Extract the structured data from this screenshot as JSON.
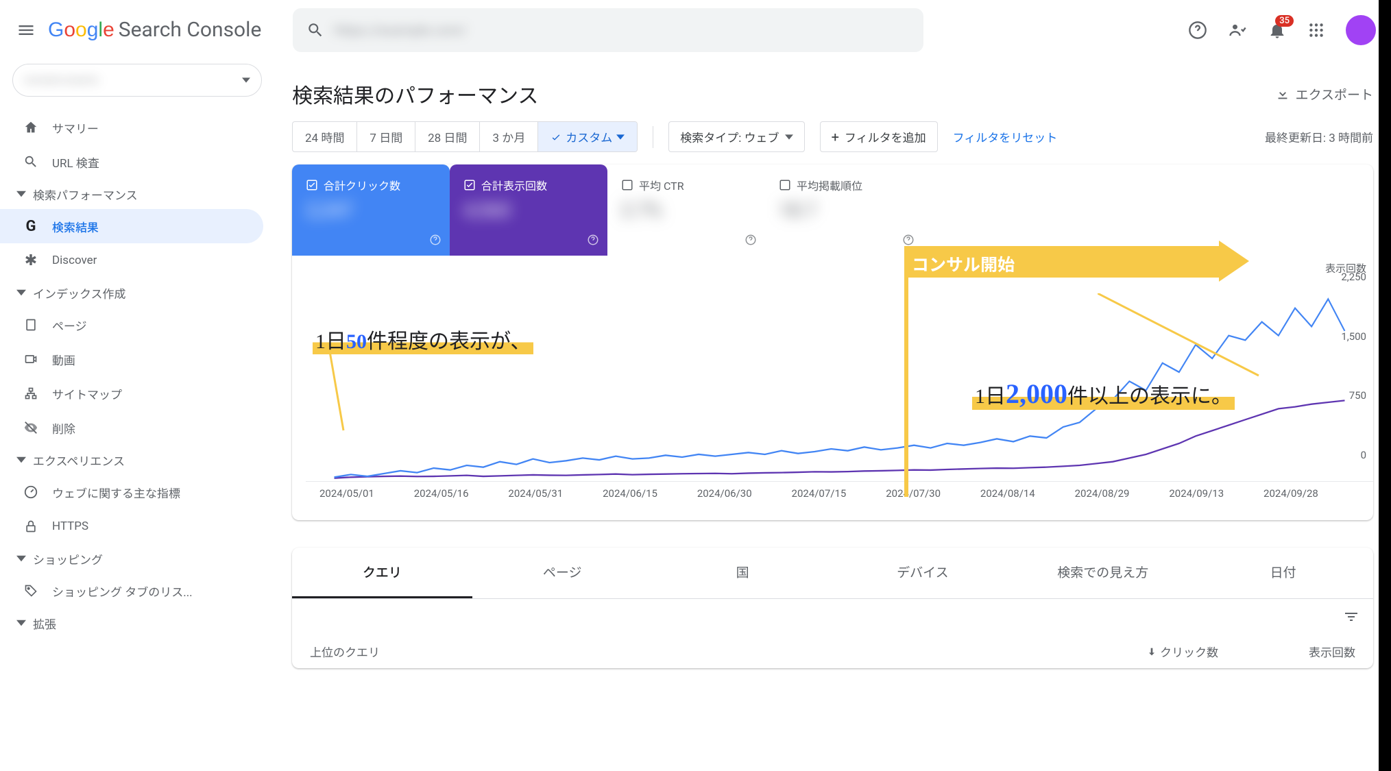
{
  "header": {
    "product": "Search Console",
    "search_placeholder": "",
    "notif_count": "35"
  },
  "sidebar": {
    "summary": "サマリー",
    "url_inspect": "URL 検査",
    "group_perf": "検索パフォーマンス",
    "search_results": "検索結果",
    "discover": "Discover",
    "group_indexing": "インデックス作成",
    "pages": "ページ",
    "video": "動画",
    "sitemaps": "サイトマップ",
    "removals": "削除",
    "group_experience": "エクスペリエンス",
    "cwv": "ウェブに関する主な指標",
    "https": "HTTPS",
    "group_shopping": "ショッピング",
    "shopping_list": "ショッピング タブのリス...",
    "group_enhancements": "拡張"
  },
  "page": {
    "title": "検索結果のパフォーマンス",
    "export": "エクスポート",
    "last_updated": "最終更新日: 3 時間前",
    "reset_filters": "フィルタをリセット"
  },
  "date_tabs": {
    "h24": "24 時間",
    "d7": "7 日間",
    "d28": "28 日間",
    "m3": "3 か月",
    "custom": "カスタム"
  },
  "filters": {
    "search_type": "検索タイプ: ウェブ",
    "add_filter": "フィルタを追加"
  },
  "metrics": {
    "clicks": "合計クリック数",
    "impressions": "合計表示回数",
    "ctr": "平均 CTR",
    "position": "平均掲載順位"
  },
  "annotations": {
    "left_pre": "1日",
    "left_num": "50",
    "left_post": "件程度の表示が、",
    "right_pre": "1日",
    "right_num": "2,000",
    "right_post": "件以上の表示に。",
    "consult_start": "コンサル開始"
  },
  "tabs": {
    "queries": "クエリ",
    "pages": "ページ",
    "countries": "国",
    "devices": "デバイス",
    "appearance": "検索での見え方",
    "dates": "日付"
  },
  "table": {
    "top_queries": "上位のクエリ",
    "clicks": "クリック数",
    "impressions": "表示回数"
  },
  "chart_data": {
    "type": "line",
    "ylabel": "表示回数",
    "ylim": [
      0,
      2250
    ],
    "y_ticks": [
      "2,250",
      "1,500",
      "750",
      "0"
    ],
    "x_ticks": [
      "2024/05/01",
      "2024/05/16",
      "2024/05/31",
      "2024/06/15",
      "2024/06/30",
      "2024/07/15",
      "2024/07/30",
      "2024/08/14",
      "2024/08/29",
      "2024/09/13",
      "2024/09/28"
    ],
    "series": [
      {
        "name": "表示回数",
        "color": "#5e35b1",
        "values": [
          40,
          50,
          55,
          60,
          62,
          58,
          60,
          65,
          70,
          60,
          65,
          70,
          75,
          72,
          70,
          75,
          80,
          85,
          78,
          82,
          85,
          88,
          90,
          92,
          88,
          94,
          98,
          100,
          105,
          110,
          108,
          112,
          118,
          120,
          125,
          130,
          128,
          135,
          140,
          145,
          150,
          148,
          155,
          160,
          170,
          180,
          200,
          220,
          260,
          300,
          360,
          420,
          500,
          560,
          620,
          680,
          740,
          800,
          820,
          850,
          870,
          890
        ]
      },
      {
        "name": "クリック数",
        "color": "#4285f4",
        "values": [
          50,
          80,
          60,
          90,
          120,
          100,
          150,
          130,
          180,
          160,
          220,
          190,
          250,
          210,
          230,
          260,
          240,
          280,
          250,
          260,
          290,
          270,
          300,
          280,
          300,
          320,
          300,
          340,
          310,
          330,
          360,
          340,
          380,
          350,
          370,
          400,
          370,
          420,
          400,
          430,
          470,
          440,
          500,
          480,
          600,
          650,
          800,
          900,
          1100,
          1000,
          1300,
          1200,
          1500,
          1350,
          1600,
          1550,
          1750,
          1600,
          1900,
          1700,
          2000,
          1650
        ]
      }
    ]
  }
}
